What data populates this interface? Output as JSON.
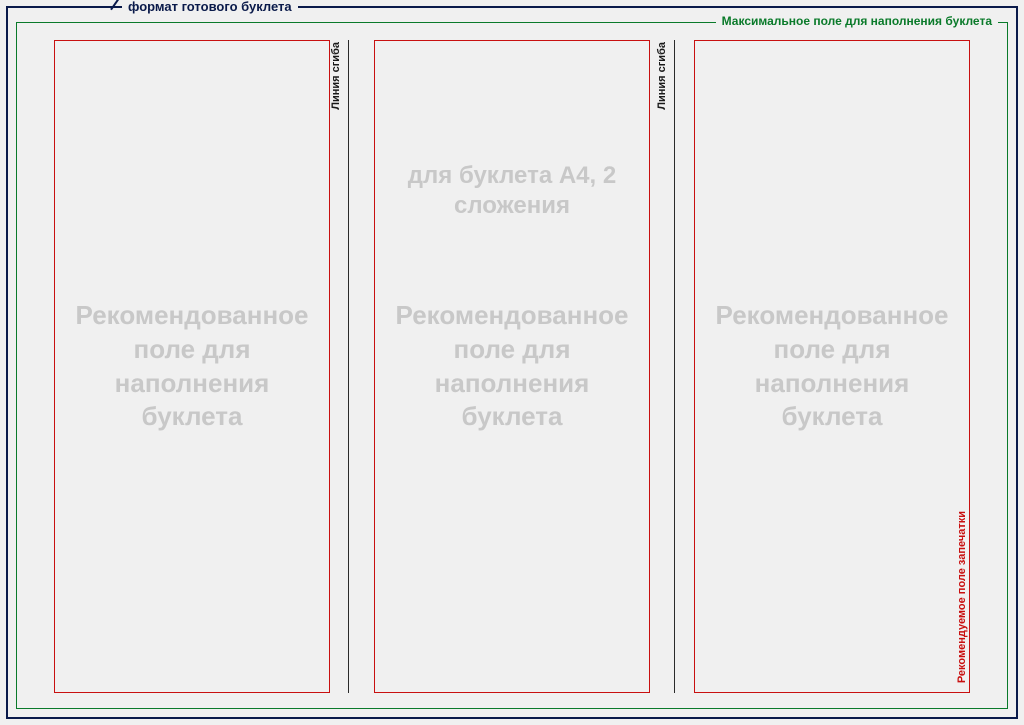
{
  "labels": {
    "format": "формат готового буклета",
    "max_field": "Максимальное поле для наполнения буклета",
    "fold": "Линия сгиба",
    "print_area": "Рекомендуемое поле запечатки"
  },
  "subtitle": "для буклета А4, 2 сложения",
  "panel_text": "Рекомендованное поле для наполнения буклета"
}
